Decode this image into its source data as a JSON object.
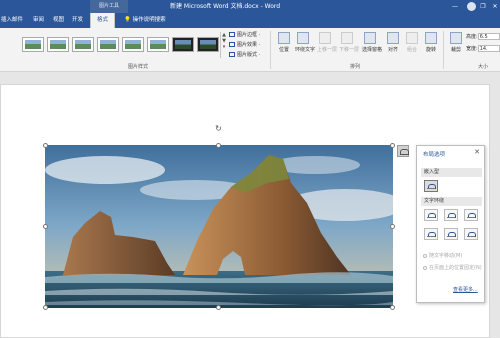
{
  "titlebar": {
    "context_tab": "图片工具",
    "title": "新建 Microsoft Word 文档.docx - Word",
    "controls": [
      "—",
      "❐",
      "✕"
    ]
  },
  "tabs": [
    {
      "label": "插入"
    },
    {
      "label": "邮件"
    },
    {
      "label": "审阅"
    },
    {
      "label": "视图"
    },
    {
      "label": "开发"
    },
    {
      "label": "格式",
      "active": true
    },
    {
      "label": "操作说明搜索"
    }
  ],
  "ribbon": {
    "styles_group_label": "图片样式",
    "picture_options": [
      "图片边框 ·",
      "图片效果 ·",
      "图片版式 ·"
    ],
    "arrange_group_label": "排列",
    "arrange_buttons": [
      {
        "label": "位置",
        "enabled": true
      },
      {
        "label": "环绕文字",
        "enabled": true
      },
      {
        "label": "上移一层",
        "enabled": false
      },
      {
        "label": "下移一层",
        "enabled": false
      },
      {
        "label": "选择窗格",
        "enabled": true
      },
      {
        "label": "对齐",
        "enabled": true
      },
      {
        "label": "组合",
        "enabled": false
      },
      {
        "label": "旋转",
        "enabled": true
      }
    ],
    "crop_label": "裁剪",
    "size_group_label": "大小",
    "height_label": "高度:",
    "height_value": "6.5",
    "width_label": "宽度:",
    "width_value": "14."
  },
  "layout_pane": {
    "title": "布局选项",
    "close": "✕",
    "inline_section": "嵌入型",
    "wrap_section": "文字环绕",
    "option_move": "随文字移动(M)",
    "option_fix": "在页面上的位置固定(N)",
    "see_more": "查看更多..."
  },
  "colors": {
    "accent": "#2b579a",
    "ribbon_bg": "#f3f3f3",
    "doc_bg": "#e6e6e6"
  }
}
